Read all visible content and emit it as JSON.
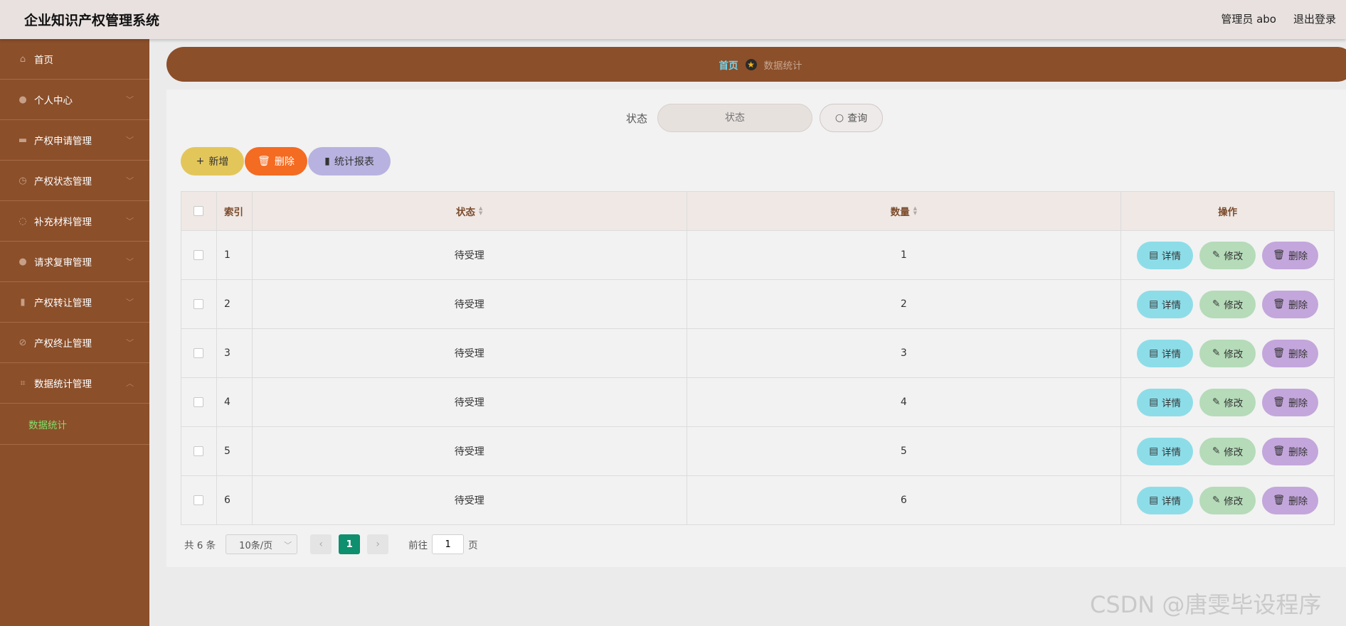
{
  "header": {
    "app_title": "企业知识产权管理系统",
    "admin_label": "管理员 abo",
    "logout_label": "退出登录"
  },
  "sidebar": {
    "items": [
      {
        "label": "首页",
        "icon": "home-icon",
        "expandable": false
      },
      {
        "label": "个人中心",
        "icon": "user-icon",
        "expandable": true
      },
      {
        "label": "产权申请管理",
        "icon": "briefcase-icon",
        "expandable": true
      },
      {
        "label": "产权状态管理",
        "icon": "gauge-icon",
        "expandable": true
      },
      {
        "label": "补充材料管理",
        "icon": "power-icon",
        "expandable": true
      },
      {
        "label": "请求复审管理",
        "icon": "user-icon",
        "expandable": true
      },
      {
        "label": "产权转让管理",
        "icon": "bar-chart-icon",
        "expandable": true
      },
      {
        "label": "产权终止管理",
        "icon": "ban-icon",
        "expandable": true
      },
      {
        "label": "数据统计管理",
        "icon": "crop-icon",
        "expandable": true,
        "expanded": true
      }
    ],
    "submenu": {
      "label": "数据统计",
      "color": "#7fe06a"
    }
  },
  "breadcrumb": {
    "home": "首页",
    "current": "数据统计"
  },
  "search": {
    "label": "状态",
    "placeholder": "状态",
    "button_label": "查询"
  },
  "toolbar": {
    "add_label": "新增",
    "delete_label": "删除",
    "report_label": "统计报表"
  },
  "table": {
    "headers": {
      "index": "索引",
      "state": "状态",
      "count": "数量",
      "ops": "操作"
    },
    "rows": [
      {
        "index": "1",
        "state": "待受理",
        "count": "1"
      },
      {
        "index": "2",
        "state": "待受理",
        "count": "2"
      },
      {
        "index": "3",
        "state": "待受理",
        "count": "3"
      },
      {
        "index": "4",
        "state": "待受理",
        "count": "4"
      },
      {
        "index": "5",
        "state": "待受理",
        "count": "5"
      },
      {
        "index": "6",
        "state": "待受理",
        "count": "6"
      }
    ],
    "op_labels": {
      "detail": "详情",
      "edit": "修改",
      "delete": "删除"
    }
  },
  "pagination": {
    "total": "共 6 条",
    "page_size": "10条/页",
    "current_page": "1",
    "goto_prefix": "前往",
    "goto_value": "1",
    "goto_suffix": "页"
  },
  "watermark": "CSDN @唐雯毕设程序",
  "colors": {
    "sidebar_bg": "#8b4f2a",
    "header_bg": "#e8e1df",
    "accent_green": "#0e8f6e",
    "add_button": "#e3c65a",
    "delete_button": "#f46b22",
    "report_button": "#b8b2e0",
    "detail_button": "#8ddde8",
    "edit_button": "#b5dbb9",
    "row_delete_button": "#c3a6db"
  }
}
